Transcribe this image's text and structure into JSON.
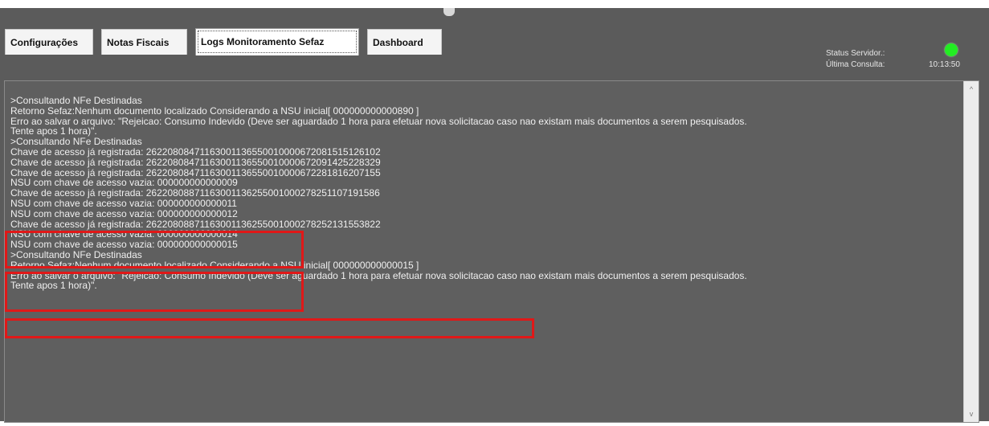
{
  "tabs": [
    {
      "label": "Configurações"
    },
    {
      "label": "Notas Fiscais"
    },
    {
      "label": "Logs Monitoramento Sefaz"
    },
    {
      "label": "Dashboard"
    }
  ],
  "status": {
    "server_label": "Status Servidor.:",
    "last_query_label": "Última Consulta:",
    "last_query_value": "10:13:50",
    "server_color": "#22ee22"
  },
  "log": {
    "lines": [
      ">Consultando NFe Destinadas",
      "Retorno Sefaz:Nenhum documento localizado Considerando a NSU inicial[ 000000000000890 ]",
      "Erro ao salvar o arquivo: \"Rejeicao: Consumo Indevido (Deve ser aguardado 1 hora para efetuar nova solicitacao caso nao existam mais documentos a serem pesquisados.",
      "Tente apos 1 hora)\".",
      ">Consultando NFe Destinadas",
      "Chave de acesso já registrada: 26220808471163001136550010000672081515126102",
      "Chave de acesso já registrada: 26220808471163001136550010000672091425228329",
      "Chave de acesso já registrada: 26220808471163001136550010000672281816207155",
      "NSU com chave de acesso vazia: 000000000000009",
      "Chave de acesso já registrada: 26220808871163001136255001000278251107191586",
      "NSU com chave de acesso vazia: 000000000000011",
      "NSU com chave de acesso vazia: 000000000000012",
      "Chave de acesso já registrada: 26220808871163001136255001000278252131553822",
      "NSU com chave de acesso vazia: 000000000000014",
      "NSU com chave de acesso vazia: 000000000000015",
      ">Consultando NFe Destinadas",
      "Retorno Sefaz:Nenhum documento localizado Considerando a NSU inicial[ 000000000000015 ]",
      "Erro ao salvar o arquivo: \"Rejeicao: Consumo Indevido (Deve ser aguardado 1 hora para efetuar nova solicitacao caso nao existam mais documentos a serem pesquisados.",
      "Tente apos 1 hora)\"."
    ]
  }
}
